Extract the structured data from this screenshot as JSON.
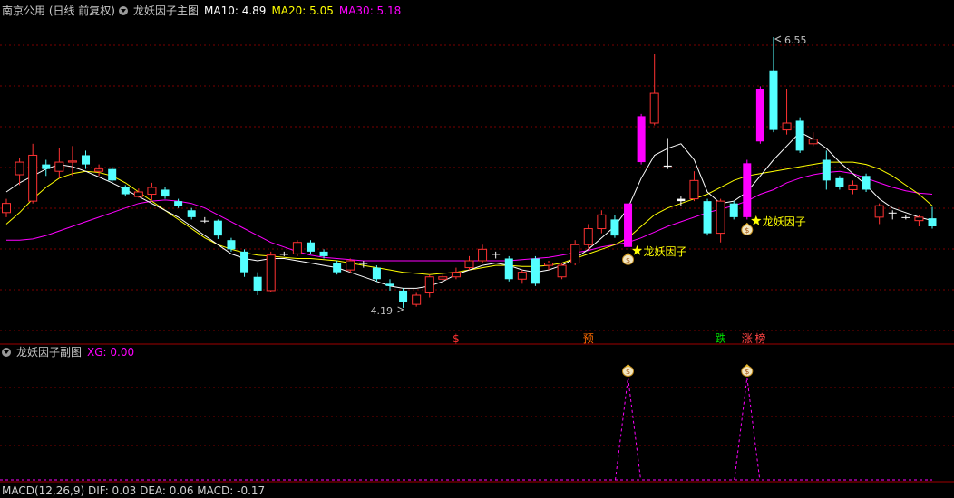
{
  "main_header": {
    "stock": "南京公用 (日线 前复权)",
    "indicator": "龙妖因子主图",
    "ma10": "MA10: 4.89",
    "ma20": "MA20: 5.05",
    "ma30": "MA30: 5.18"
  },
  "sub_header": {
    "indicator": "龙妖因子副图",
    "xg": "XG: 0.00"
  },
  "bottom_header": {
    "text": "MACD(12,26,9) DIF: 0.03 DEA: 0.06 MACD: -0.17"
  },
  "colors": {
    "up": "#ff3232",
    "down": "#54ffff",
    "magenta": "#ff00ff",
    "ma10": "#ffffff",
    "ma20": "#ffff00",
    "ma30": "#ff00ff",
    "grid": "#7a0000"
  },
  "chart_data": {
    "type": "candlestick",
    "y_range": [
      4.0,
      6.7
    ],
    "max_label": "6.55",
    "min_label": "4.19",
    "candles": [
      {
        "o": 5.02,
        "c": 5.1,
        "h": 5.14,
        "l": 4.98,
        "t": "up"
      },
      {
        "o": 5.35,
        "c": 5.46,
        "h": 5.5,
        "l": 5.26,
        "t": "up"
      },
      {
        "o": 5.12,
        "c": 5.52,
        "h": 5.62,
        "l": 5.1,
        "t": "up"
      },
      {
        "o": 5.44,
        "c": 5.4,
        "h": 5.48,
        "l": 5.34,
        "t": "down"
      },
      {
        "o": 5.38,
        "c": 5.46,
        "h": 5.58,
        "l": 5.32,
        "t": "up"
      },
      {
        "o": 5.46,
        "c": 5.47,
        "h": 5.6,
        "l": 5.34,
        "t": "up"
      },
      {
        "o": 5.52,
        "c": 5.44,
        "h": 5.56,
        "l": 5.4,
        "t": "down"
      },
      {
        "o": 5.38,
        "c": 5.4,
        "h": 5.44,
        "l": 5.34,
        "t": "up"
      },
      {
        "o": 5.4,
        "c": 5.3,
        "h": 5.42,
        "l": 5.28,
        "t": "down"
      },
      {
        "o": 5.24,
        "c": 5.18,
        "h": 5.26,
        "l": 5.16,
        "t": "down"
      },
      {
        "o": 5.16,
        "c": 5.2,
        "h": 5.23,
        "l": 5.15,
        "t": "up"
      },
      {
        "o": 5.18,
        "c": 5.24,
        "h": 5.28,
        "l": 5.13,
        "t": "up"
      },
      {
        "o": 5.22,
        "c": 5.16,
        "h": 5.24,
        "l": 5.14,
        "t": "down"
      },
      {
        "o": 5.12,
        "c": 5.08,
        "h": 5.14,
        "l": 5.06,
        "t": "down"
      },
      {
        "o": 5.04,
        "c": 4.98,
        "h": 5.06,
        "l": 4.96,
        "t": "down"
      },
      {
        "o": 4.95,
        "c": 4.95,
        "h": 4.98,
        "l": 4.93,
        "t": "flat"
      },
      {
        "o": 4.95,
        "c": 4.82,
        "h": 4.96,
        "l": 4.79,
        "t": "down"
      },
      {
        "o": 4.78,
        "c": 4.7,
        "h": 4.8,
        "l": 4.68,
        "t": "down"
      },
      {
        "o": 4.68,
        "c": 4.5,
        "h": 4.7,
        "l": 4.46,
        "t": "down"
      },
      {
        "o": 4.46,
        "c": 4.34,
        "h": 4.5,
        "l": 4.3,
        "t": "down"
      },
      {
        "o": 4.34,
        "c": 4.65,
        "h": 4.68,
        "l": 4.33,
        "t": "up"
      },
      {
        "o": 4.66,
        "c": 4.66,
        "h": 4.68,
        "l": 4.64,
        "t": "flat"
      },
      {
        "o": 4.66,
        "c": 4.76,
        "h": 4.78,
        "l": 4.64,
        "t": "up"
      },
      {
        "o": 4.76,
        "c": 4.68,
        "h": 4.78,
        "l": 4.66,
        "t": "down"
      },
      {
        "o": 4.68,
        "c": 4.64,
        "h": 4.7,
        "l": 4.62,
        "t": "down"
      },
      {
        "o": 4.58,
        "c": 4.5,
        "h": 4.6,
        "l": 4.48,
        "t": "down"
      },
      {
        "o": 4.52,
        "c": 4.6,
        "h": 4.62,
        "l": 4.49,
        "t": "up"
      },
      {
        "o": 4.58,
        "c": 4.58,
        "h": 4.6,
        "l": 4.54,
        "t": "flat"
      },
      {
        "o": 4.54,
        "c": 4.44,
        "h": 4.56,
        "l": 4.42,
        "t": "down"
      },
      {
        "o": 4.4,
        "c": 4.38,
        "h": 4.44,
        "l": 4.34,
        "t": "down"
      },
      {
        "o": 4.34,
        "c": 4.24,
        "h": 4.36,
        "l": 4.19,
        "t": "down"
      },
      {
        "o": 4.22,
        "c": 4.3,
        "h": 4.32,
        "l": 4.2,
        "t": "up"
      },
      {
        "o": 4.32,
        "c": 4.46,
        "h": 4.48,
        "l": 4.28,
        "t": "up"
      },
      {
        "o": 4.44,
        "c": 4.46,
        "h": 4.48,
        "l": 4.42,
        "t": "up"
      },
      {
        "o": 4.46,
        "c": 4.5,
        "h": 4.54,
        "l": 4.44,
        "t": "up"
      },
      {
        "o": 4.54,
        "c": 4.6,
        "h": 4.64,
        "l": 4.52,
        "t": "up"
      },
      {
        "o": 4.6,
        "c": 4.7,
        "h": 4.74,
        "l": 4.58,
        "t": "up"
      },
      {
        "o": 4.66,
        "c": 4.66,
        "h": 4.68,
        "l": 4.62,
        "t": "flat"
      },
      {
        "o": 4.62,
        "c": 4.44,
        "h": 4.64,
        "l": 4.42,
        "t": "down"
      },
      {
        "o": 4.44,
        "c": 4.5,
        "h": 4.52,
        "l": 4.4,
        "t": "up"
      },
      {
        "o": 4.62,
        "c": 4.4,
        "h": 4.64,
        "l": 4.38,
        "t": "down"
      },
      {
        "o": 4.56,
        "c": 4.58,
        "h": 4.6,
        "l": 4.52,
        "t": "up"
      },
      {
        "o": 4.46,
        "c": 4.56,
        "h": 4.58,
        "l": 4.44,
        "t": "up"
      },
      {
        "o": 4.58,
        "c": 4.74,
        "h": 4.78,
        "l": 4.56,
        "t": "up"
      },
      {
        "o": 4.74,
        "c": 4.88,
        "h": 4.92,
        "l": 4.7,
        "t": "up"
      },
      {
        "o": 4.88,
        "c": 5.0,
        "h": 5.04,
        "l": 4.84,
        "t": "up"
      },
      {
        "o": 4.96,
        "c": 4.82,
        "h": 5.0,
        "l": 4.8,
        "t": "down"
      },
      {
        "o": 4.72,
        "c": 5.1,
        "h": 5.12,
        "l": 4.7,
        "t": "mag"
      },
      {
        "o": 5.46,
        "c": 5.86,
        "h": 5.88,
        "l": 5.44,
        "t": "mag"
      },
      {
        "o": 5.8,
        "c": 6.06,
        "h": 6.4,
        "l": 5.78,
        "t": "up"
      },
      {
        "o": 5.43,
        "c": 5.42,
        "h": 5.67,
        "l": 5.4,
        "t": "flat"
      },
      {
        "o": 5.14,
        "c": 5.12,
        "h": 5.16,
        "l": 5.08,
        "t": "flat"
      },
      {
        "o": 5.14,
        "c": 5.3,
        "h": 5.38,
        "l": 5.12,
        "t": "up"
      },
      {
        "o": 5.12,
        "c": 4.84,
        "h": 5.14,
        "l": 4.82,
        "t": "down"
      },
      {
        "o": 4.84,
        "c": 5.12,
        "h": 5.14,
        "l": 4.76,
        "t": "up"
      },
      {
        "o": 5.1,
        "c": 4.98,
        "h": 5.12,
        "l": 4.96,
        "t": "down"
      },
      {
        "o": 4.98,
        "c": 5.45,
        "h": 5.48,
        "l": 4.96,
        "t": "mag"
      },
      {
        "o": 5.64,
        "c": 6.1,
        "h": 6.12,
        "l": 5.62,
        "t": "mag"
      },
      {
        "o": 6.26,
        "c": 5.74,
        "h": 6.55,
        "l": 5.72,
        "t": "down"
      },
      {
        "o": 5.74,
        "c": 5.8,
        "h": 6.1,
        "l": 5.7,
        "t": "up"
      },
      {
        "o": 5.82,
        "c": 5.56,
        "h": 5.85,
        "l": 5.54,
        "t": "down"
      },
      {
        "o": 5.62,
        "c": 5.66,
        "h": 5.72,
        "l": 5.6,
        "t": "up"
      },
      {
        "o": 5.48,
        "c": 5.3,
        "h": 5.56,
        "l": 5.22,
        "t": "down"
      },
      {
        "o": 5.32,
        "c": 5.24,
        "h": 5.34,
        "l": 5.22,
        "t": "down"
      },
      {
        "o": 5.22,
        "c": 5.26,
        "h": 5.3,
        "l": 5.18,
        "t": "up"
      },
      {
        "o": 5.34,
        "c": 5.22,
        "h": 5.36,
        "l": 5.2,
        "t": "down"
      },
      {
        "o": 5.08,
        "c": 4.98,
        "h": 5.1,
        "l": 4.92,
        "t": "up"
      },
      {
        "o": 5.02,
        "c": 5.02,
        "h": 5.04,
        "l": 4.96,
        "t": "flat"
      },
      {
        "o": 4.98,
        "c": 4.98,
        "h": 5.0,
        "l": 4.96,
        "t": "flat"
      },
      {
        "o": 4.98,
        "c": 4.95,
        "h": 5.0,
        "l": 4.9,
        "t": "up"
      },
      {
        "o": 4.97,
        "c": 4.9,
        "h": 5.07,
        "l": 4.88,
        "t": "down"
      }
    ],
    "ma10": [
      5.2,
      5.28,
      5.34,
      5.4,
      5.44,
      5.42,
      5.38,
      5.33,
      5.28,
      5.22,
      5.16,
      5.1,
      5.04,
      4.98,
      4.9,
      4.82,
      4.74,
      4.66,
      4.62,
      4.6,
      4.62,
      4.62,
      4.6,
      4.58,
      4.56,
      4.54,
      4.5,
      4.46,
      4.42,
      4.38,
      4.36,
      4.36,
      4.38,
      4.42,
      4.48,
      4.52,
      4.56,
      4.58,
      4.56,
      4.52,
      4.5,
      4.52,
      4.56,
      4.62,
      4.7,
      4.8,
      4.9,
      5.06,
      5.32,
      5.52,
      5.58,
      5.62,
      5.48,
      5.2,
      5.1,
      5.12,
      5.2,
      5.34,
      5.48,
      5.6,
      5.72,
      5.66,
      5.58,
      5.46,
      5.36,
      5.26,
      5.14,
      5.06,
      5.02,
      4.98,
      4.95
    ],
    "ma20": [
      4.92,
      5.02,
      5.14,
      5.24,
      5.32,
      5.36,
      5.38,
      5.37,
      5.34,
      5.28,
      5.2,
      5.12,
      5.04,
      4.96,
      4.88,
      4.8,
      4.74,
      4.7,
      4.67,
      4.65,
      4.64,
      4.63,
      4.62,
      4.62,
      4.61,
      4.6,
      4.58,
      4.56,
      4.54,
      4.52,
      4.5,
      4.49,
      4.48,
      4.49,
      4.5,
      4.52,
      4.54,
      4.56,
      4.56,
      4.55,
      4.55,
      4.56,
      4.58,
      4.62,
      4.66,
      4.7,
      4.74,
      4.8,
      4.9,
      5.0,
      5.06,
      5.1,
      5.14,
      5.18,
      5.24,
      5.3,
      5.34,
      5.36,
      5.38,
      5.4,
      5.42,
      5.44,
      5.46,
      5.46,
      5.46,
      5.44,
      5.4,
      5.34,
      5.26,
      5.18,
      5.08
    ],
    "ma30": [
      4.78,
      4.78,
      4.79,
      4.82,
      4.86,
      4.9,
      4.94,
      4.98,
      5.02,
      5.06,
      5.1,
      5.12,
      5.13,
      5.12,
      5.1,
      5.06,
      5.0,
      4.94,
      4.88,
      4.82,
      4.76,
      4.72,
      4.68,
      4.65,
      4.63,
      4.62,
      4.61,
      4.6,
      4.6,
      4.6,
      4.6,
      4.6,
      4.6,
      4.6,
      4.6,
      4.6,
      4.6,
      4.6,
      4.6,
      4.61,
      4.62,
      4.63,
      4.65,
      4.67,
      4.69,
      4.72,
      4.74,
      4.76,
      4.8,
      4.85,
      4.9,
      4.94,
      4.98,
      5.02,
      5.05,
      5.08,
      5.12,
      5.18,
      5.22,
      5.28,
      5.32,
      5.35,
      5.37,
      5.38,
      5.36,
      5.32,
      5.28,
      5.24,
      5.21,
      5.19,
      5.18
    ],
    "signals": [
      {
        "index": 47,
        "label": "龙妖因子"
      },
      {
        "index": 56,
        "label": "龙妖因子"
      }
    ],
    "bottom_markers": [
      {
        "index": 34,
        "label": "$",
        "color": "#ff3232"
      },
      {
        "index": 44,
        "label": "预",
        "color": "#ff6a00"
      },
      {
        "index": 54,
        "label": "跌",
        "color": "#00dd00"
      },
      {
        "index": 56,
        "label": "涨",
        "color": "#ff4444"
      },
      {
        "index": 57,
        "label": "榜",
        "color": "#ff4444"
      }
    ],
    "sub_chart": {
      "series_name": "XG",
      "values_spikes": [
        47,
        56
      ]
    }
  }
}
